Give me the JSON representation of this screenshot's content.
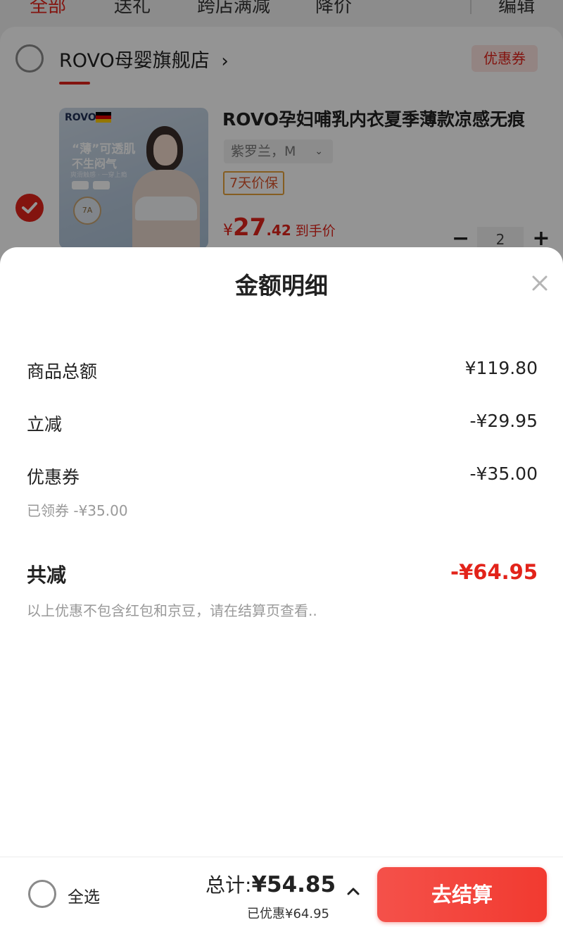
{
  "tabs": [
    {
      "label": "全部",
      "active": true
    },
    {
      "label": "送礼",
      "active": false
    },
    {
      "label": "跨店满减",
      "active": false
    },
    {
      "label": "降价",
      "active": false
    }
  ],
  "header": {
    "edit_label": "编辑"
  },
  "shop": {
    "name": "ROVO母婴旗舰店",
    "chevron": "›",
    "coupon_button": "优惠券"
  },
  "product": {
    "image": {
      "brand_text": "ROVO",
      "slogan_1": "“薄”可透肌",
      "slogan_2": "不生闷气",
      "slogan_3": "爽滑触感 · 一穿上瘾",
      "seal_text": "7A"
    },
    "title": "ROVO孕妇哺乳内衣夏季薄款凉感无痕",
    "sku": "紫罗兰，M",
    "guarantee_tag": "7天价保",
    "price_currency": "¥",
    "price_int": "27",
    "price_dec": ".42",
    "price_label": "到手价",
    "quantity": "2",
    "selected": true
  },
  "sheet": {
    "title": "金额明细",
    "rows": [
      {
        "label": "商品总额",
        "value": "¥119.80"
      },
      {
        "label": "立减",
        "value": "-¥29.95"
      },
      {
        "label": "优惠券",
        "value": "-¥35.00",
        "sub": "已领券 -¥35.00"
      }
    ],
    "total": {
      "label": "共减",
      "value": "-¥64.95"
    },
    "note": "以上优惠不包含红包和京豆，请在结算页查看.."
  },
  "bottom_bar": {
    "select_all": "全选",
    "total_label": "总计:",
    "total_value": "¥54.85",
    "saved": "已优惠¥64.95",
    "checkout": "去结算"
  },
  "colors": {
    "accent": "#e2231a",
    "overlay": "rgba(0,0,0,0.42)",
    "coupon_bg": "#fde3e1",
    "guarantee_border": "#e6a13a"
  },
  "icons": [
    "chevron-right-icon",
    "checkmark-icon",
    "chevron-down-icon",
    "minus-icon",
    "plus-icon",
    "close-icon",
    "chevron-up-icon"
  ]
}
